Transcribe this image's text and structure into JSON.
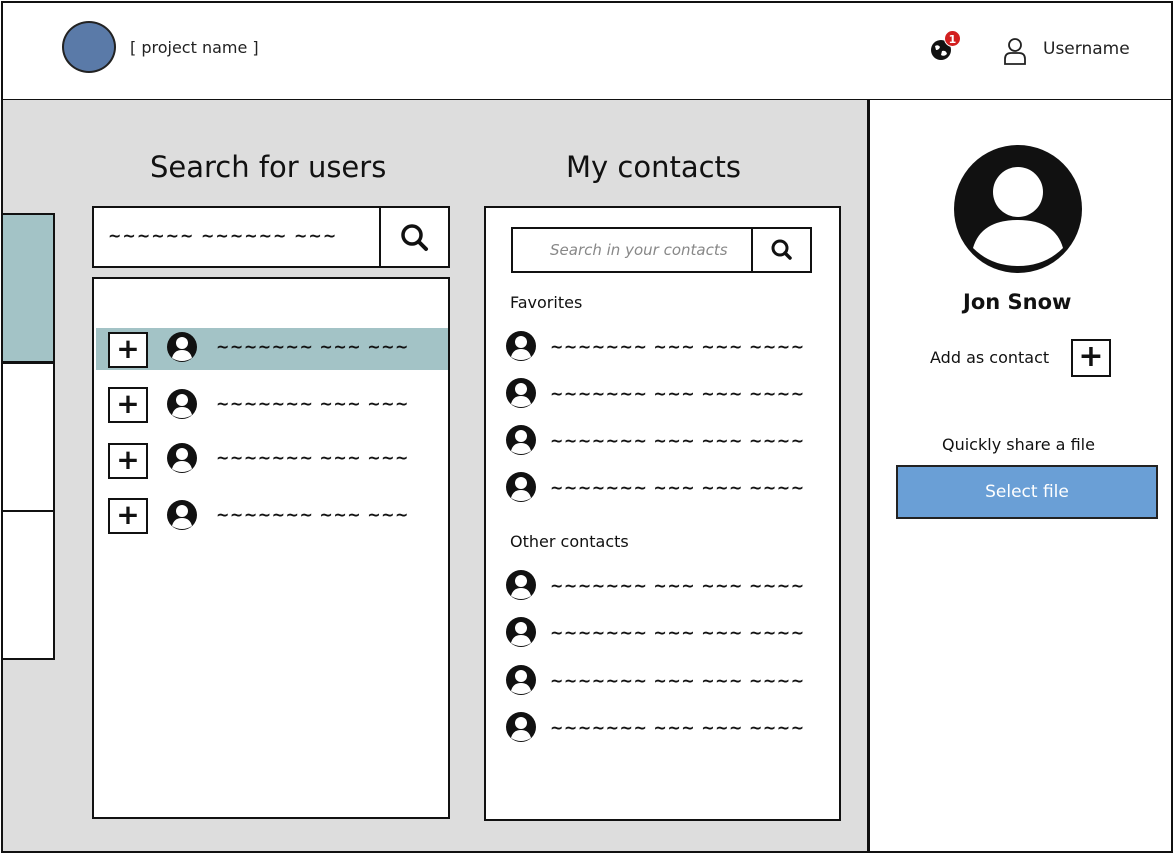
{
  "header": {
    "project_name": "[ project name ]",
    "notification_count": "1",
    "username": "Username"
  },
  "search_users": {
    "title": "Search for users",
    "query": "~~~~~~  ~~~~~~ ~~~",
    "results": [
      {
        "name": "~~~~~~~ ~~~ ~~~",
        "selected": true
      },
      {
        "name": "~~~~~~~ ~~~ ~~~",
        "selected": false
      },
      {
        "name": "~~~~~~~ ~~~ ~~~",
        "selected": false
      },
      {
        "name": "~~~~~~~ ~~~ ~~~",
        "selected": false
      }
    ]
  },
  "contacts": {
    "title": "My contacts",
    "search_placeholder": "Search in your contacts",
    "favorites_label": "Favorites",
    "favorites": [
      "~~~~~~~ ~~~ ~~~ ~~~~",
      "~~~~~~~ ~~~ ~~~ ~~~~",
      "~~~~~~~ ~~~ ~~~ ~~~~",
      "~~~~~~~ ~~~ ~~~ ~~~~"
    ],
    "other_label": "Other contacts",
    "others": [
      "~~~~~~~ ~~~ ~~~ ~~~~",
      "~~~~~~~ ~~~ ~~~ ~~~~",
      "~~~~~~~ ~~~ ~~~ ~~~~",
      "~~~~~~~ ~~~ ~~~ ~~~~"
    ]
  },
  "profile": {
    "name": "Jon Snow",
    "add_contact_label": "Add as contact",
    "add_symbol": "+",
    "share_label": "Quickly share a file",
    "select_file_label": "Select file"
  },
  "colors": {
    "accent_selected": "#a3c3c6",
    "button_blue": "#6a9fd6",
    "badge_red": "#d21f1f",
    "logo_blue": "#5a7aa8",
    "main_bg": "#dddddd"
  }
}
